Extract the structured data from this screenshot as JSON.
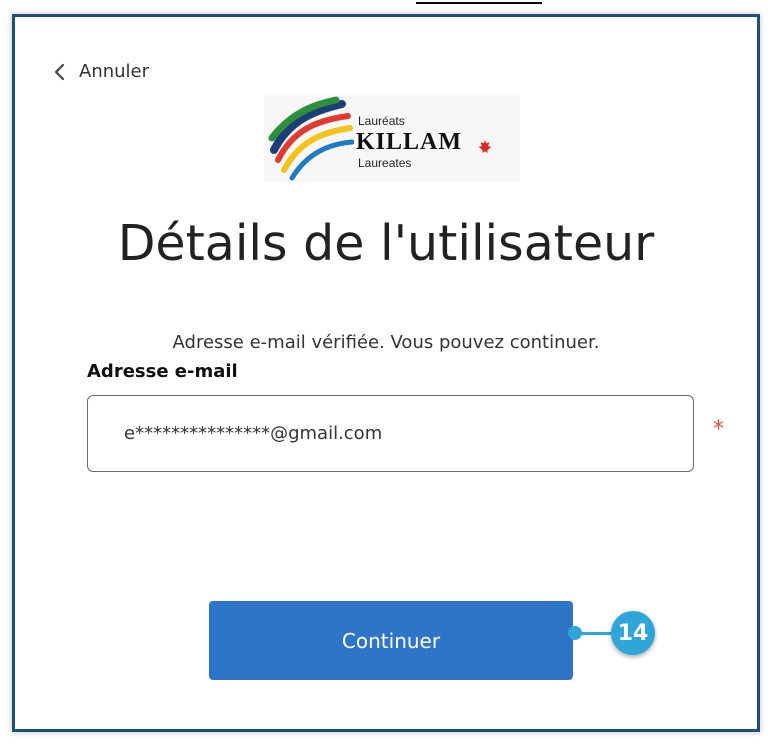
{
  "cancel": {
    "label": "Annuler",
    "icon": "chevron-left-icon"
  },
  "logo": {
    "top_text": "Lauréats",
    "main_text": "KILLAM",
    "bottom_text": "Laureates",
    "maple_leaf_icon": "maple-leaf-icon"
  },
  "page": {
    "title": "Détails de l'utilisateur",
    "status": "Adresse e-mail vérifiée. Vous pouvez continuer."
  },
  "email": {
    "label": "Adresse e-mail",
    "value": "e***************@gmail.com",
    "required_mark": "*"
  },
  "actions": {
    "continue_label": "Continuer"
  },
  "callout": {
    "number": "14"
  },
  "colors": {
    "primary_button": "#2f75c7",
    "callout": "#2ea6d9",
    "required": "#e74c3c",
    "border": "#1f4e79"
  }
}
